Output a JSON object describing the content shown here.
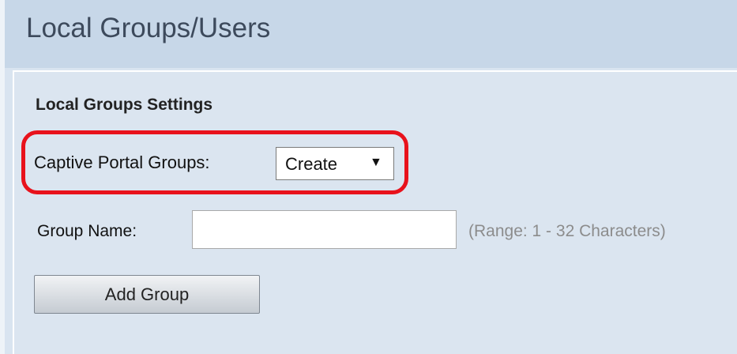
{
  "page": {
    "title": "Local Groups/Users"
  },
  "settings": {
    "section_title": "Local Groups Settings",
    "captive_portal_groups": {
      "label": "Captive Portal Groups:",
      "selected": "Create"
    },
    "group_name": {
      "label": "Group Name:",
      "value": "",
      "hint": "(Range: 1 - 32 Characters)"
    },
    "add_group_label": "Add Group"
  },
  "colors": {
    "highlight": "#e8121c",
    "header_bg": "#c7d7e8",
    "panel_bg": "#dbe5f0"
  }
}
